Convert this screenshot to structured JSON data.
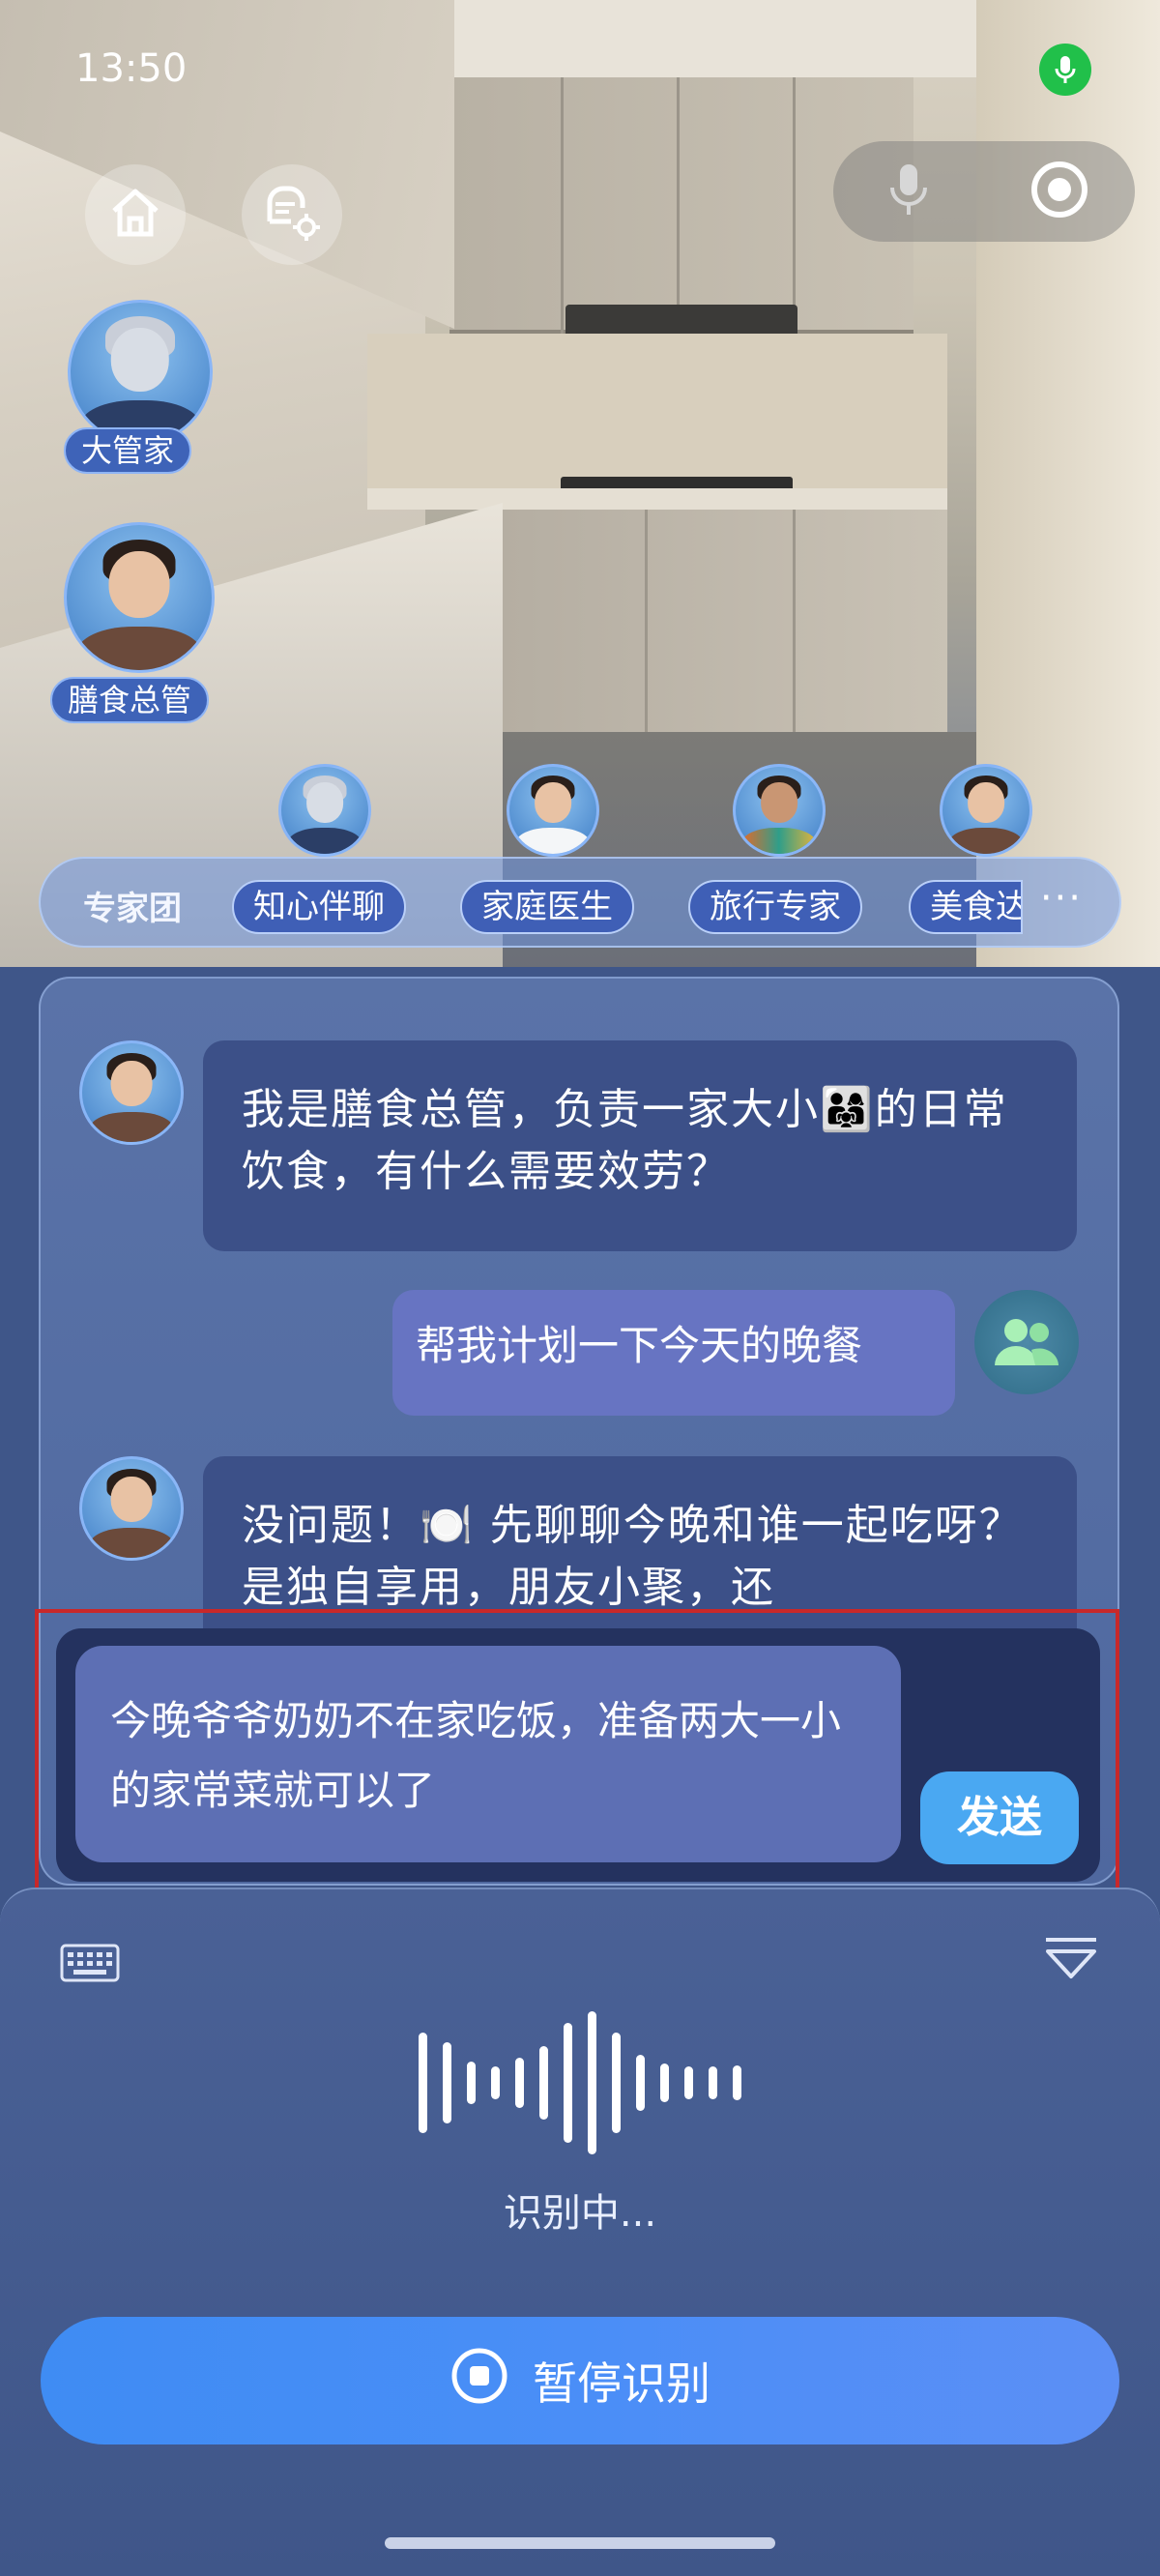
{
  "status_bar": {
    "time": "13:50"
  },
  "top_bar": {
    "home_icon": "home-icon",
    "settings_icon": "device-settings-icon",
    "mic_icon": "microphone-icon",
    "record_icon": "record-icon"
  },
  "personas": [
    {
      "label": "大管家",
      "icon": "robot-butler-avatar"
    },
    {
      "label": "膳食总管",
      "icon": "chef-avatar"
    }
  ],
  "expert_team": {
    "title": "专家团",
    "chips": [
      "知心伴聊",
      "家庭医生",
      "旅行专家",
      "美食达"
    ],
    "more_label": "···"
  },
  "chat": {
    "messages": [
      {
        "role": "ai",
        "text": "我是膳食总管，负责一家大小👨‍👩‍👧的日常饮食，有什么需要效劳？"
      },
      {
        "role": "user",
        "text": "帮我计划一下今天的晚餐"
      },
      {
        "role": "ai",
        "text": "没问题！🍽️ 先聊聊今晚和谁一起吃呀？是独自享用，朋友小聚，还"
      }
    ]
  },
  "input": {
    "text": "今晚爷爷奶奶不在家吃饭，准备两大一小的家常菜就可以了",
    "send_label": "发送"
  },
  "voice": {
    "status": "识别中...",
    "pause_label": "暂停识别",
    "keyboard_icon": "keyboard-icon",
    "collapse_icon": "chevron-down-icon"
  },
  "colors": {
    "accent": "#4aa8f2",
    "pause_button": "#4a8ef7",
    "highlight_border": "#c8282a"
  }
}
